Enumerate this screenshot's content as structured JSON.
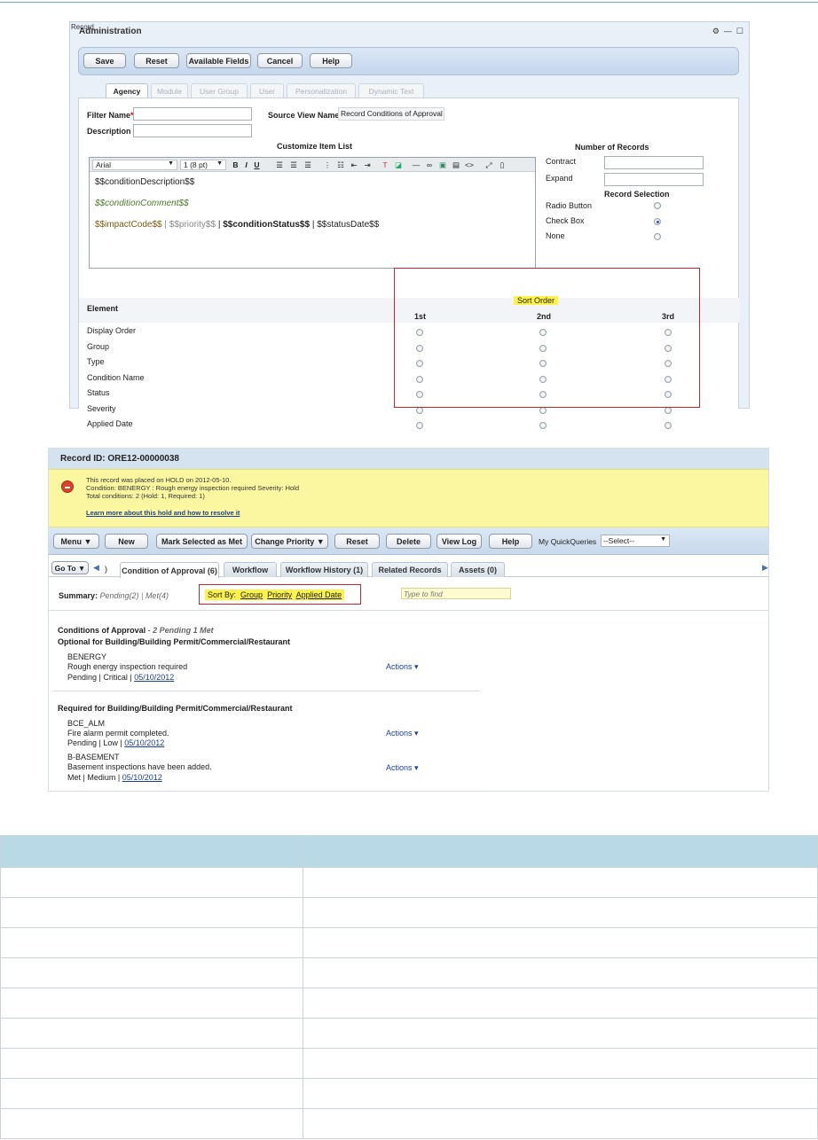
{
  "panel1": {
    "window_label": "Record",
    "title": "Administration",
    "window_controls": [
      "⚙",
      "—",
      "☐"
    ],
    "toolbar": [
      "Save",
      "Reset",
      "Available Fields",
      "Cancel",
      "Help"
    ],
    "tabs": [
      "Agency",
      "Module",
      "User Group",
      "User",
      "Personalization",
      "Dynamic Text"
    ],
    "filter_name_label": "Filter Name",
    "required_mark": "*",
    "description_label": "Description",
    "source_view_label": "Source View Name",
    "source_view_value": "Record Conditions of Approval",
    "customize_label": "Customize Item List",
    "editor": {
      "font": "Arial",
      "size": "1 (8 pt)",
      "line1": "$$conditionDescription$$",
      "line2": "$$conditionComment$$",
      "line3_a": "$$impactCode$$",
      "line3_b": "$$priority$$",
      "line3_c": "$$conditionStatus$$",
      "line3_d": "$$statusDate$$",
      "sep": "|"
    },
    "number_of_records_label": "Number of Records",
    "contract_label": "Contract",
    "expand_label": "Expand",
    "record_selection_label": "Record Selection",
    "selection_options": [
      "Radio Button",
      "Check Box",
      "None"
    ],
    "selected_option": "Check Box",
    "sort_order_label": "Sort Order",
    "element_label": "Element",
    "sort_columns": [
      "1st",
      "2nd",
      "3rd"
    ],
    "elements": [
      "Display Order",
      "Group",
      "Type",
      "Condition Name",
      "Status",
      "Severity",
      "Applied Date"
    ]
  },
  "panel2": {
    "record_id": "Record ID: ORE12-00000038",
    "hold_lines": [
      "This record was placed on HOLD on 2012-05-10.",
      "Condition: BENERGY : Rough energy inspection required Severity: Hold",
      "Total conditions: 2   (Hold: 1, Required: 1)"
    ],
    "hold_link": "Learn more about this hold and how to resolve it",
    "toolbar": [
      "Menu",
      "New",
      "Mark Selected as Met",
      "Change Priority",
      "Reset",
      "Delete",
      "View Log",
      "Help"
    ],
    "quick_queries_label": "My QuickQueries",
    "quick_queries_value": "--Select--",
    "goto_label": "Go To",
    "tab_stub": ")",
    "tabs": [
      "Condition of Approval (6)",
      "Workflow",
      "Workflow History (1)",
      "Related Records",
      "Assets (0)"
    ],
    "summary_label": "Summary:",
    "summary_pending": "Pending(2)",
    "summary_met": "Met(4)",
    "sort_by_label": "Sort By:",
    "sort_by_options": [
      "Group",
      "Priority",
      "Applied Date"
    ],
    "find_placeholder": "Type to find",
    "coa_title": "Conditions of Approval",
    "coa_counts": "2 Pending  1 Met",
    "group1_title": "Optional for Building/Building Permit/Commercial/Restaurant",
    "group2_title": "Required for Building/Building Permit/Commercial/Restaurant",
    "actions_label": "Actions",
    "conditions": [
      {
        "name": "BENERGY",
        "desc": "Rough energy inspection required",
        "status": "Pending | Critical | ",
        "date": "05/10/2012"
      },
      {
        "name": "BCE_ALM",
        "desc": "Fire alarm permit completed.",
        "status": "Pending | Low | ",
        "date": "05/10/2012"
      },
      {
        "name": "B-BASEMENT",
        "desc": "Basement inspections have been added.",
        "status": "Met | Medium | ",
        "date": "05/10/2012"
      }
    ]
  },
  "colors": {
    "highlight": "#fdf24a",
    "red_box": "#c1272d",
    "table_header": "#b8d9e5",
    "hold_banner": "#fbf7a1",
    "toolbar_blue": "#d5e3f1"
  }
}
